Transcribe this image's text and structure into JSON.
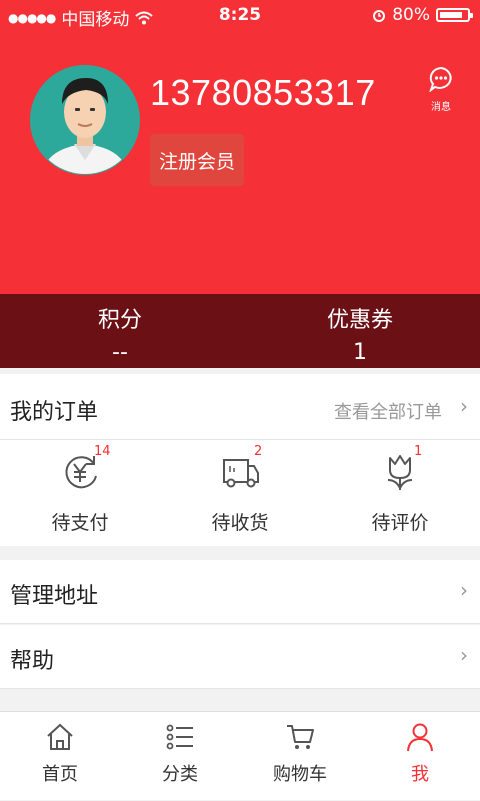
{
  "status_bar": {
    "carrier": "中国移动",
    "time": "8:25",
    "battery": "80%"
  },
  "profile": {
    "phone": "13780853317",
    "register_label": "注册会员",
    "message_label": "消息"
  },
  "stats": [
    {
      "title": "积分",
      "value": "--"
    },
    {
      "title": "优惠券",
      "value": "1"
    }
  ],
  "orders": {
    "title": "我的订单",
    "view_all": "查看全部订单",
    "statuses": [
      {
        "label": "待支付",
        "badge": "14",
        "icon": "yen-cycle-icon"
      },
      {
        "label": "待收货",
        "badge": "2",
        "icon": "truck-icon"
      },
      {
        "label": "待评价",
        "badge": "1",
        "icon": "flower-icon"
      }
    ]
  },
  "menu": [
    {
      "label": "管理地址"
    },
    {
      "label": "帮助"
    }
  ],
  "tabs": [
    {
      "label": "首页",
      "icon": "home-icon"
    },
    {
      "label": "分类",
      "icon": "list-icon"
    },
    {
      "label": "购物车",
      "icon": "cart-icon"
    },
    {
      "label": "我",
      "icon": "person-icon",
      "active": true
    }
  ],
  "colors": {
    "accent": "#f53036",
    "dark_band": "#6b1116"
  }
}
